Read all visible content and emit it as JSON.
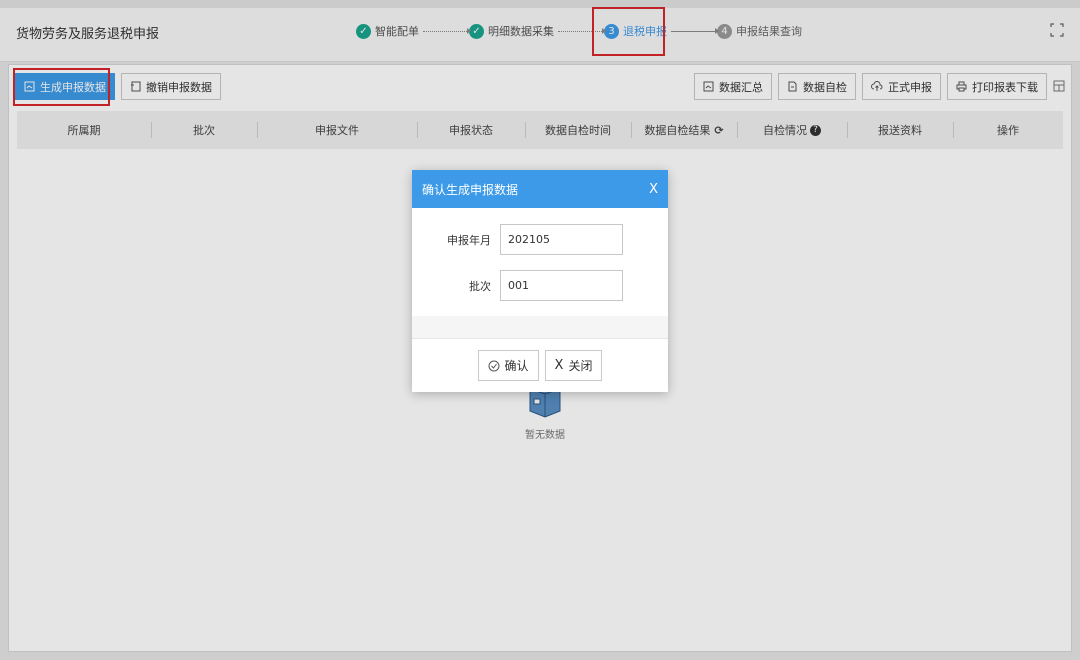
{
  "page_title": "货物劳务及服务退税申报",
  "steps": [
    {
      "label": "智能配单",
      "status": "done"
    },
    {
      "label": "明细数据采集",
      "status": "done"
    },
    {
      "number": "3",
      "label": "退税申报",
      "status": "active"
    },
    {
      "number": "4",
      "label": "申报结果查询",
      "status": "todo"
    }
  ],
  "toolbar": {
    "generate": "生成申报数据",
    "cancel": "撤销申报数据",
    "summary": "数据汇总",
    "selfcheck": "数据自检",
    "formal": "正式申报",
    "print": "打印报表下载"
  },
  "table": {
    "columns": [
      "所属期",
      "批次",
      "申报文件",
      "申报状态",
      "数据自检时间",
      "数据自检结果",
      "自检情况",
      "报送资料",
      "操作"
    ],
    "empty_text": "暂无数据"
  },
  "modal": {
    "title": "确认生成申报数据",
    "close": "X",
    "fields": [
      {
        "label": "申报年月",
        "value": "202105"
      },
      {
        "label": "批次",
        "value": "001"
      }
    ],
    "confirm": "确认",
    "cancel": "关闭"
  },
  "colors": {
    "accent": "#3d9ae8",
    "done": "#1aa58f",
    "highlight": "#d9262b"
  }
}
